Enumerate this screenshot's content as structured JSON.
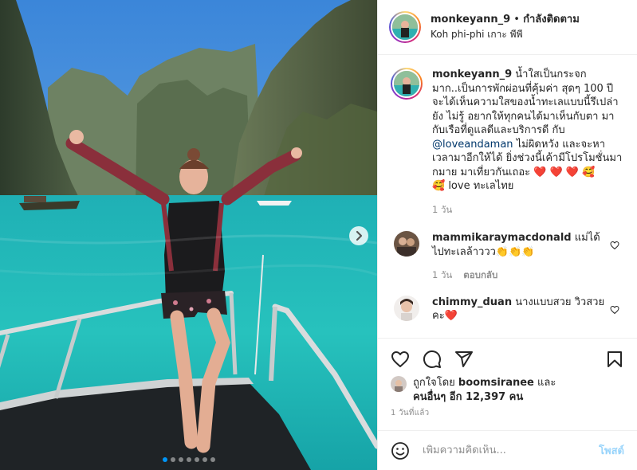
{
  "header": {
    "username": "monkeyann_9",
    "separator": "•",
    "follow_label": "กำลังติดตาม",
    "location": "Koh phi-phi เกาะ พีพี"
  },
  "caption": {
    "username": "monkeyann_9",
    "text_part1": "น้ำใสเป็นกระจกมาก..เป็นการพักผ่อนที่คุ้มค่า สุดๆ 100 ปีจะได้เห็นความใสของน้ำทะเลแบบนี้รึเปล่ายัง ไม่รู้ อยากให้ทุกคนได้มาเห็นกับตา มากับเรือที่ดูแลดีและบริการดี กับ ",
    "mention": "@loveandaman",
    "text_part2": " ไม่ผิดหวัง และจะหาเวลามาอีกให้ได้ ยิ่งช่วงนี้เค้ามีโปรโมชั่นมากมาย มาเที่ยวกันเถอะ ",
    "hearts": "❤️ ❤️ ❤️",
    "emoji_end": "🥰",
    "emoji_start_line": "🥰",
    "text_part3": " love ทะเลไทย",
    "age": "1 วัน"
  },
  "comments": [
    {
      "username": "mammikaraymacdonald",
      "text": " แม่ได้ไปทะเลล้าววว",
      "emojis": "👏👏👏",
      "age": "1 วัน",
      "reply_label": "ตอบกลับ"
    },
    {
      "username": "chimmy_duan",
      "text": " นางแบบสวย วิวสวยคะ",
      "emojis": "❤️"
    }
  ],
  "likes": {
    "prefix": "ถูกใจโดย ",
    "liker": "boomsiranee",
    "middle": " และ",
    "others_label": "คนอื่นๆ อีก 12,397 คน"
  },
  "timestamp": "1 วันที่แล้ว",
  "add_comment": {
    "placeholder": "เพิ่มความคิดเห็น...",
    "post_label": "โพสต์"
  },
  "carousel": {
    "total_slides": 7,
    "active_index": 0
  },
  "colors": {
    "link": "#00376b",
    "accent": "#0095f6",
    "heart": "#ed4956",
    "water": "#2bb8b6"
  }
}
